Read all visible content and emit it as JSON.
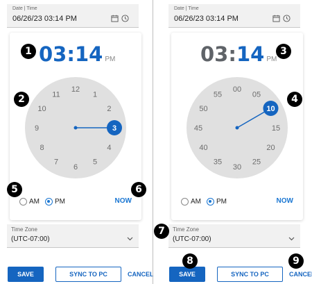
{
  "left": {
    "datetime": {
      "label": "Date | Time",
      "value": "06/26/23 03:14 PM"
    },
    "time": {
      "hour": "03",
      "colon": ":",
      "minute": "14",
      "suffix": "PM"
    },
    "dial": {
      "mode": "hours",
      "labels": [
        "12",
        "1",
        "2",
        "3",
        "4",
        "5",
        "6",
        "7",
        "8",
        "9",
        "10",
        "11"
      ],
      "selected": "3"
    },
    "ampm": {
      "am_label": "AM",
      "pm_label": "PM",
      "selected": "PM"
    },
    "now_label": "NOW",
    "timezone": {
      "label": "Time Zone",
      "value": "(UTC-07:00)"
    },
    "buttons": {
      "save": "SAVE",
      "sync": "SYNC TO PC",
      "cancel": "CANCEL"
    }
  },
  "right": {
    "datetime": {
      "label": "Date | Time",
      "value": "06/26/23 03:14 PM"
    },
    "time": {
      "hour": "03",
      "colon": ":",
      "minute": "14",
      "suffix": "PM"
    },
    "dial": {
      "mode": "minutes",
      "labels": [
        "00",
        "05",
        "10",
        "15",
        "20",
        "25",
        "30",
        "35",
        "40",
        "45",
        "50",
        "55"
      ],
      "selected": "10"
    },
    "ampm": {
      "am_label": "AM",
      "pm_label": "PM",
      "selected": "PM"
    },
    "now_label": "NOW",
    "timezone": {
      "label": "Time Zone",
      "value": "(UTC-07:00)"
    },
    "buttons": {
      "save": "SAVE",
      "sync": "SYNC TO PC",
      "cancel": "CANCEL"
    }
  },
  "callouts": [
    "1",
    "2",
    "3",
    "4",
    "5",
    "6",
    "7",
    "8",
    "9"
  ],
  "colors": {
    "accent": "#1565c0",
    "dial_face": "#e0e0e0",
    "callout_bg": "#000000"
  },
  "icons": {
    "calendar": "calendar-icon",
    "clock": "clock-icon",
    "dropdown": "chevron-down-icon"
  }
}
